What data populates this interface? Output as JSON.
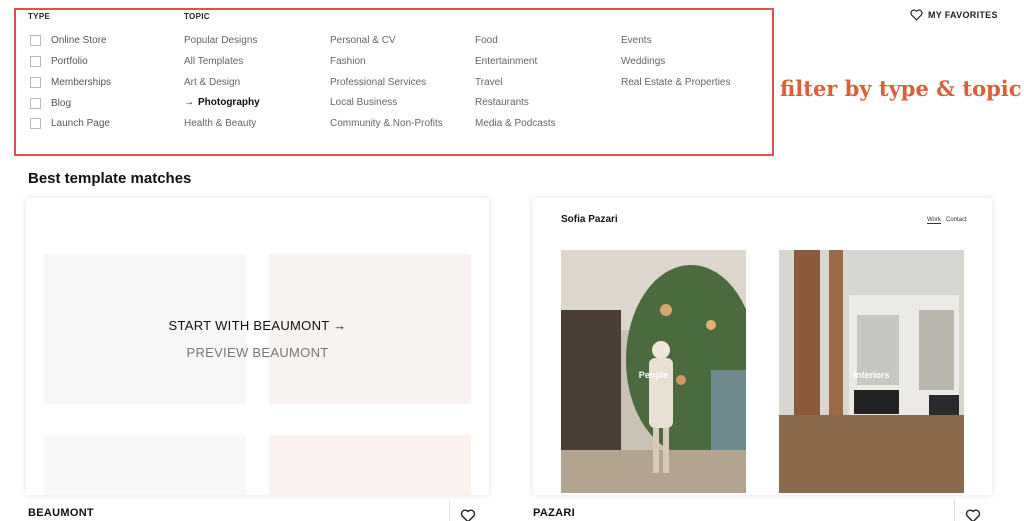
{
  "filters": {
    "type_heading": "TYPE",
    "topic_heading": "TOPIC",
    "types": [
      "Online Store",
      "Portfolio",
      "Memberships",
      "Blog",
      "Launch Page"
    ],
    "topics": {
      "col1": [
        "Popular Designs",
        "All Templates",
        "Art & Design",
        "Photography",
        "Health & Beauty"
      ],
      "col2": [
        "Personal & CV",
        "Fashion",
        "Professional Services",
        "Local Business",
        "Community & Non-Profits"
      ],
      "col3": [
        "Food",
        "Entertainment",
        "Travel",
        "Restaurants",
        "Media & Podcasts"
      ],
      "col4": [
        "Events",
        "Weddings",
        "Real Estate & Properties"
      ]
    },
    "active_topic": "Photography",
    "active_arrow": "→"
  },
  "annotation": "filter by type & topic",
  "favorites": {
    "label": "MY FAVORITES",
    "icon": "heart-icon"
  },
  "section_title": "Best template matches",
  "templates": [
    {
      "name": "BEAUMONT",
      "start_label": "START WITH BEAUMONT →",
      "preview_label": "PREVIEW BEAUMONT"
    },
    {
      "name": "PAZARI",
      "site_name": "Sofia Pazari",
      "nav": [
        "Work",
        "Contact"
      ],
      "photos": [
        "People",
        "Interiors"
      ]
    }
  ],
  "colors": {
    "annotation_red": "#d9603b",
    "highlight_border": "#d9534f"
  }
}
